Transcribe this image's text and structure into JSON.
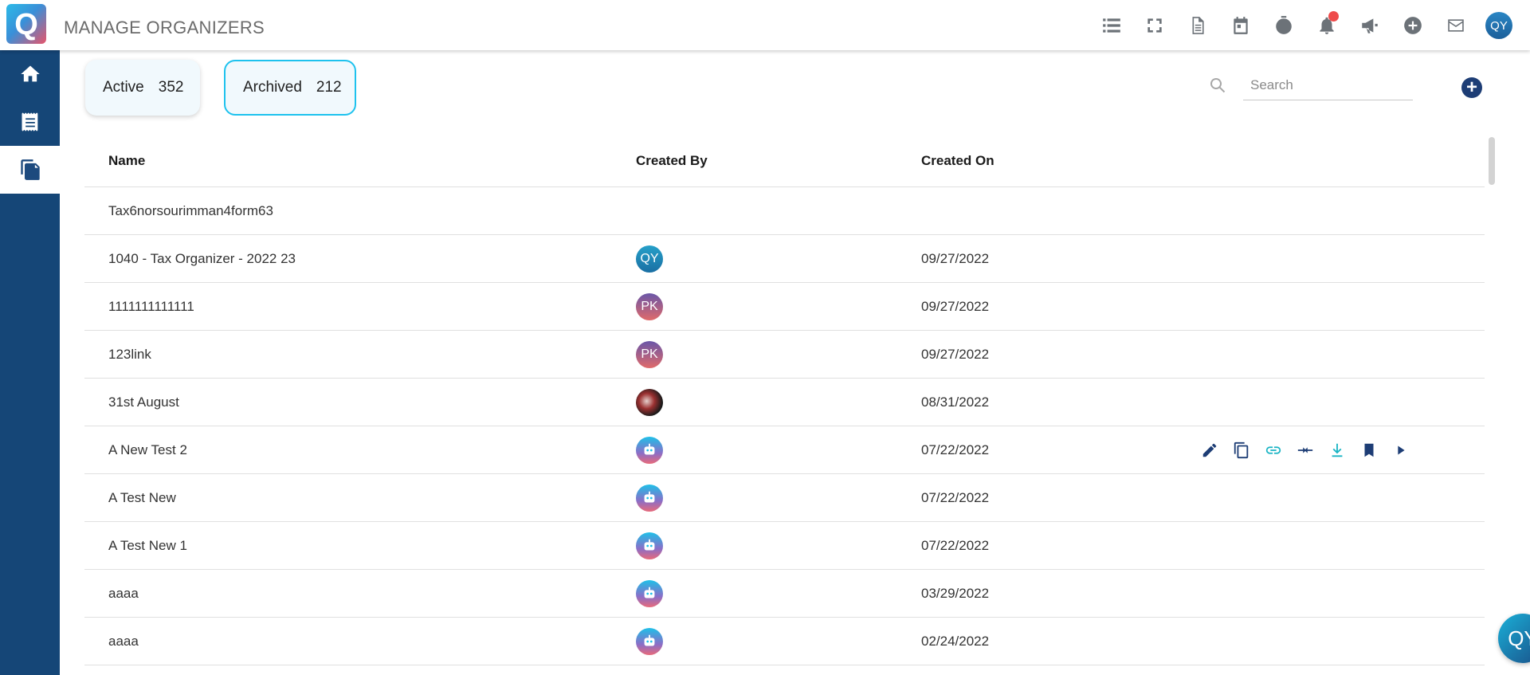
{
  "header": {
    "title": "MANAGE ORGANIZERS",
    "logo_letter": "Q",
    "user_initials": "QY",
    "icons": [
      "list-icon",
      "fullscreen-icon",
      "document-icon",
      "calendar-icon",
      "timer-icon",
      "bell-icon",
      "megaphone-icon",
      "add-circle-icon",
      "mail-icon"
    ]
  },
  "sidebar": {
    "items": [
      {
        "name": "home",
        "icon": "home-icon",
        "active": false
      },
      {
        "name": "receipt",
        "icon": "receipt-icon",
        "active": false
      },
      {
        "name": "organizers",
        "icon": "copy-files-icon",
        "active": true
      }
    ]
  },
  "filters": {
    "active_label": "Active",
    "active_count": "352",
    "archived_label": "Archived",
    "archived_count": "212"
  },
  "search": {
    "placeholder": "Search",
    "value": ""
  },
  "table": {
    "columns": [
      "Name",
      "Created By",
      "Created On"
    ],
    "rows": [
      {
        "name": "Tax6norsourimman4form63",
        "created_by": "",
        "avatar": "none",
        "created_on": ""
      },
      {
        "name": "1040 - Tax Organizer - 2022 23",
        "created_by": "QY",
        "avatar": "qy",
        "created_on": "09/27/2022"
      },
      {
        "name": "1111111111111",
        "created_by": "PK",
        "avatar": "pk",
        "created_on": "09/27/2022"
      },
      {
        "name": "123link",
        "created_by": "PK",
        "avatar": "pk",
        "created_on": "09/27/2022"
      },
      {
        "name": "31st August",
        "created_by": "",
        "avatar": "photo",
        "created_on": "08/31/2022"
      },
      {
        "name": "A New Test 2",
        "created_by": "",
        "avatar": "bot",
        "created_on": "07/22/2022"
      },
      {
        "name": "A Test New",
        "created_by": "",
        "avatar": "bot",
        "created_on": "07/22/2022"
      },
      {
        "name": "A Test New 1",
        "created_by": "",
        "avatar": "bot",
        "created_on": "07/22/2022"
      },
      {
        "name": "aaaa",
        "created_by": "",
        "avatar": "bot",
        "created_on": "03/29/2022"
      },
      {
        "name": "aaaa",
        "created_by": "",
        "avatar": "bot",
        "created_on": "02/24/2022"
      }
    ],
    "row_actions": [
      "edit-icon",
      "copy-icon",
      "link-icon",
      "merge-icon",
      "download-icon",
      "bookmark-icon",
      "play-icon"
    ]
  },
  "floating": {
    "initials": "QY"
  },
  "colors": {
    "sidebar_bg": "#154677",
    "accent": "#1ec2ee",
    "action_icon": "#1d3d75",
    "notification": "#ee4b4b"
  }
}
